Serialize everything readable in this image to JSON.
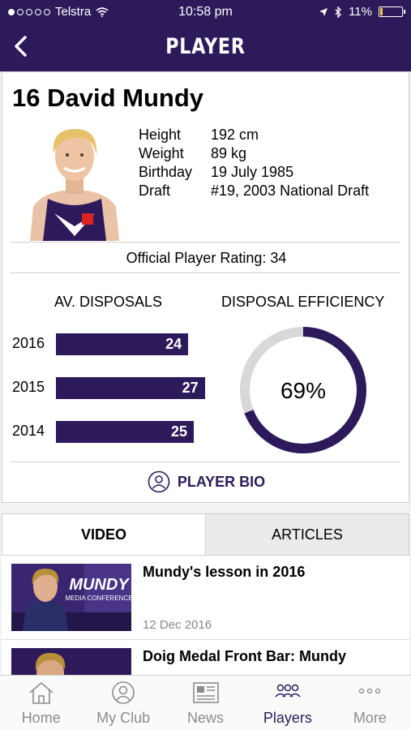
{
  "status": {
    "carrier": "Telstra",
    "time": "10:58 pm",
    "battery": "11%",
    "battery_level": 0.11
  },
  "nav": {
    "title": "PLAYER"
  },
  "player": {
    "number_name": "16 David Mundy",
    "info": [
      {
        "label": "Height",
        "value": "192 cm"
      },
      {
        "label": "Weight",
        "value": "89 kg"
      },
      {
        "label": "Birthday",
        "value": "19 July 1985"
      },
      {
        "label": "Draft",
        "value": "#19, 2003 National Draft"
      }
    ],
    "rating_text": "Official Player Rating: 34"
  },
  "stats": {
    "disposals_title": "AV. DISPOSALS",
    "efficiency_title": "DISPOSAL EFFICIENCY",
    "disposals": [
      {
        "year": "2016",
        "value": "24"
      },
      {
        "year": "2015",
        "value": "27"
      },
      {
        "year": "2014",
        "value": "25"
      }
    ],
    "efficiency_value": 69,
    "efficiency_label": "69%"
  },
  "bio_label": "PLAYER BIO",
  "tabs": {
    "video": "VIDEO",
    "articles": "ARTICLES"
  },
  "videos": [
    {
      "title": "Mundy's lesson in 2016",
      "date": "12 Dec 2016",
      "thumb_text": "MUNDY",
      "thumb_sub": "MEDIA CONFERENCE"
    },
    {
      "title": "Doig Medal Front Bar: Mundy",
      "date": ""
    }
  ],
  "tabbar": [
    {
      "label": "Home",
      "icon": "home-icon"
    },
    {
      "label": "My Club",
      "icon": "club-icon"
    },
    {
      "label": "News",
      "icon": "news-icon"
    },
    {
      "label": "Players",
      "icon": "players-icon"
    },
    {
      "label": "More",
      "icon": "more-icon"
    }
  ],
  "colors": {
    "purple": "#2d1a5b",
    "donut_track": "#d8d8d8",
    "inactive": "#8c8c8c"
  }
}
